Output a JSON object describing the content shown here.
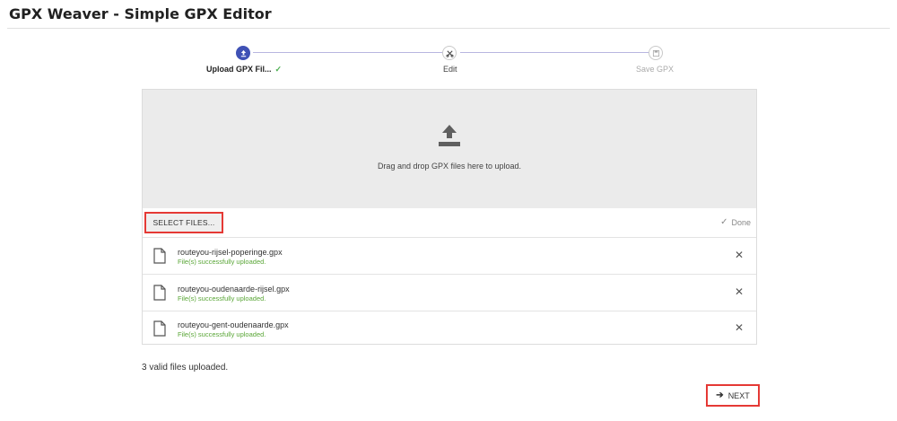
{
  "header": {
    "title": "GPX Weaver - Simple GPX Editor"
  },
  "stepper": {
    "steps": [
      {
        "label": "Upload GPX Fil...",
        "state": "active",
        "icon": "upload-icon",
        "completed_icon": "✓"
      },
      {
        "label": "Edit",
        "state": "idle",
        "icon": "scissors-icon"
      },
      {
        "label": "Save GPX",
        "state": "disabled",
        "icon": "save-icon"
      }
    ],
    "accent": "#3f51b5"
  },
  "upload": {
    "drop_text": "Drag and drop GPX files here to upload.",
    "select_label": "SELECT FILES...",
    "done_label": "Done",
    "files": [
      {
        "name": "routeyou-rijsel-poperinge.gpx",
        "status": "File(s) successfully uploaded."
      },
      {
        "name": "routeyou-oudenaarde-rijsel.gpx",
        "status": "File(s) successfully uploaded."
      },
      {
        "name": "routeyou-gent-oudenaarde.gpx",
        "status": "File(s) successfully uploaded."
      }
    ],
    "remove_symbol": "✕",
    "success_color": "#5aa637"
  },
  "summary": "3 valid files uploaded.",
  "actions": {
    "next_label": "NEXT",
    "next_arrow": "➔"
  }
}
